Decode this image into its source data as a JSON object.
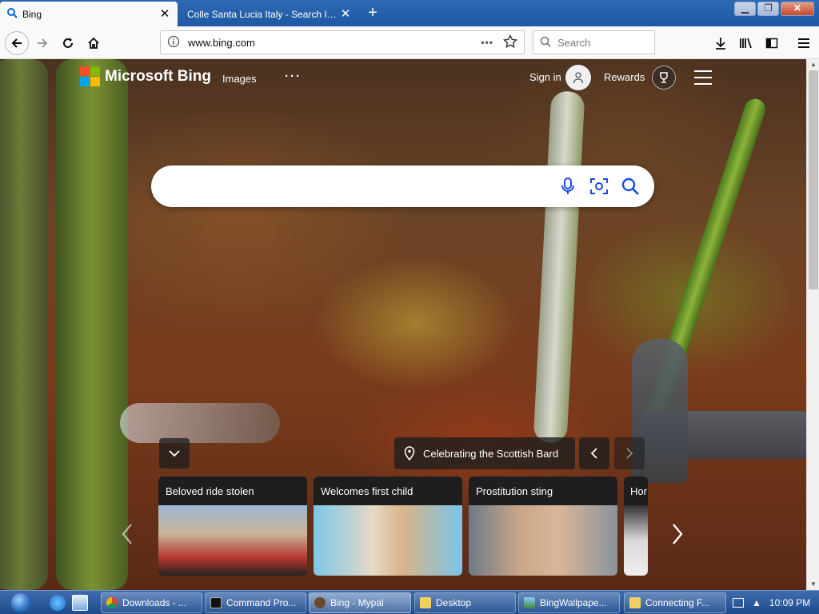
{
  "browser": {
    "tabs": [
      {
        "label": "Bing",
        "active": true
      },
      {
        "label": "Colle Santa Lucia Italy - Search Imag",
        "active": false
      }
    ],
    "url": "www.bing.com",
    "search_placeholder": "Search"
  },
  "bing": {
    "brand": "Microsoft Bing",
    "nav_images": "Images",
    "sign_in": "Sign in",
    "rewards": "Rewards",
    "image_caption": "Celebrating the Scottish Bard",
    "cards": [
      {
        "title": "Beloved ride stolen"
      },
      {
        "title": "Welcomes first child"
      },
      {
        "title": "Prostitution sting"
      },
      {
        "title": "Hor"
      }
    ]
  },
  "taskbar": {
    "items": [
      {
        "label": "Downloads - ...",
        "icon": "chrome-icon",
        "active": false
      },
      {
        "label": "Command Pro...",
        "icon": "terminal-icon",
        "active": false
      },
      {
        "label": "Bing - Mypal",
        "icon": "mypal-icon",
        "active": true
      },
      {
        "label": "Desktop",
        "icon": "folder-icon",
        "active": false
      },
      {
        "label": "BingWallpape...",
        "icon": "image-icon",
        "active": false
      },
      {
        "label": "Connecting F...",
        "icon": "folder-icon",
        "active": false
      }
    ],
    "clock": "10:09 PM"
  },
  "colors": {
    "tab_strip": "#2e6ab3",
    "taskbar": "#1d4c8e",
    "bing_accent": "#174ae4"
  }
}
